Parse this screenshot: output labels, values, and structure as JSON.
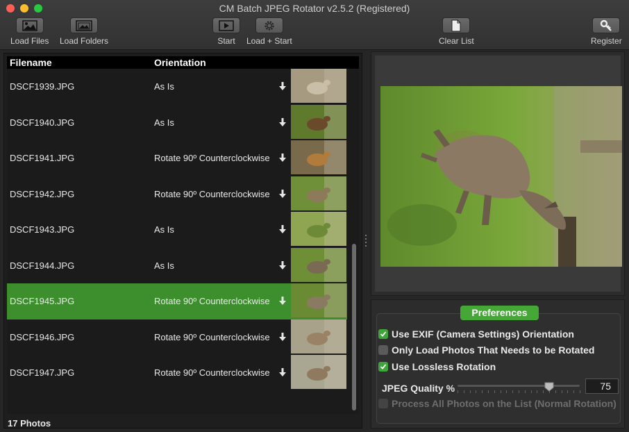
{
  "window": {
    "title": "CM Batch JPEG Rotator v2.5.2 (Registered)"
  },
  "toolbar": {
    "load_files": {
      "label": "Load Files",
      "icon": "image-icon"
    },
    "load_folders": {
      "label": "Load Folders",
      "icon": "folder-image-icon"
    },
    "start": {
      "label": "Start",
      "icon": "play-icon"
    },
    "load_start": {
      "label": "Load + Start",
      "icon": "gear-icon"
    },
    "clear_list": {
      "label": "Clear List",
      "icon": "document-icon"
    },
    "register": {
      "label": "Register",
      "icon": "key-icon"
    }
  },
  "list": {
    "columns": [
      "Filename",
      "Orientation"
    ],
    "rows": [
      {
        "filename": "DSCF1939.JPG",
        "orientation": "As Is",
        "selected": false
      },
      {
        "filename": "DSCF1940.JPG",
        "orientation": "As Is",
        "selected": false
      },
      {
        "filename": "DSCF1941.JPG",
        "orientation": "Rotate 90º Counterclockwise",
        "selected": false
      },
      {
        "filename": "DSCF1942.JPG",
        "orientation": "Rotate 90º Counterclockwise",
        "selected": false
      },
      {
        "filename": "DSCF1943.JPG",
        "orientation": "As Is",
        "selected": false
      },
      {
        "filename": "DSCF1944.JPG",
        "orientation": "As Is",
        "selected": false
      },
      {
        "filename": "DSCF1945.JPG",
        "orientation": "Rotate 90º Counterclockwise",
        "selected": true
      },
      {
        "filename": "DSCF1946.JPG",
        "orientation": "Rotate 90º Counterclockwise",
        "selected": false
      },
      {
        "filename": "DSCF1947.JPG",
        "orientation": "Rotate 90º Counterclockwise",
        "selected": false
      }
    ],
    "count_label": "17 Photos"
  },
  "preferences": {
    "title": "Preferences",
    "use_exif": {
      "label": "Use EXIF (Camera Settings) Orientation",
      "checked": true
    },
    "only_load": {
      "label": "Only Load Photos That Needs to be Rotated",
      "checked": false
    },
    "lossless": {
      "label": "Use Lossless Rotation",
      "checked": true
    },
    "jpeg_quality_label": "JPEG Quality %",
    "jpeg_quality": "75",
    "jpeg_quality_fraction": 0.75,
    "process_all": {
      "label": "Process All Photos on the List (Normal Rotation)",
      "checked": false,
      "disabled": true
    }
  },
  "colors": {
    "selected_row": "#3d8f2e",
    "accent_green": "#45a735",
    "checkbox_on": "#3fa53a"
  }
}
